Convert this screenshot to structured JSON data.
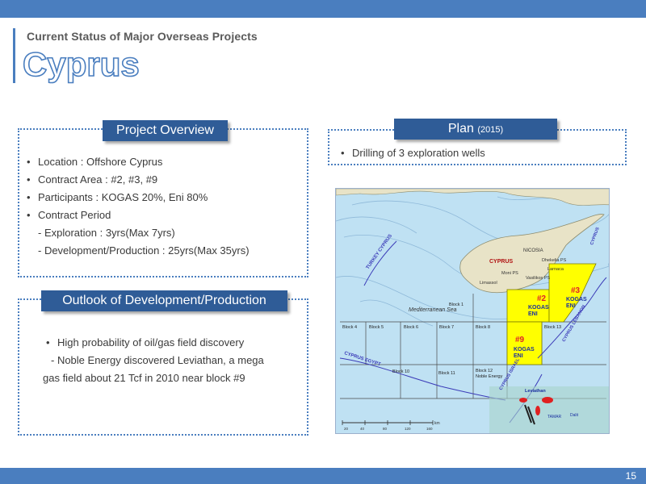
{
  "header": {
    "subtitle": "Current Status of Major Overseas Projects",
    "title": "Cyprus"
  },
  "overview": {
    "header": "Project Overview",
    "items": [
      "Location : Offshore Cyprus",
      "Contract Area : #2, #3, #9",
      "Participants : KOGAS 20%, Eni 80%",
      "Contract Period"
    ],
    "sub_items": [
      "- Exploration :  3yrs(Max 7yrs)",
      "- Development/Production : 25yrs(Max 35yrs)"
    ]
  },
  "plan": {
    "header": "Plan",
    "header_year": "(2015)",
    "items": [
      "Drilling of 3 exploration wells"
    ]
  },
  "outlook": {
    "header": "Outlook of Development/Production",
    "item": "High probability of oil/gas field discovery",
    "detail_line1": "- Noble Energy discovered Leviathan, a mega",
    "detail_line2": "gas field about 21 Tcf in 2010 near block #9"
  },
  "map": {
    "land_label": "CYPRUS",
    "city_nicosia": "NICOSIA",
    "city_dhekelia": "Dhekelia PS",
    "city_larnaca": "Larnaca",
    "city_moni": "Moni PS",
    "city_vasilikos": "Vasilikos PS",
    "city_limassol": "Limassol",
    "sea_label": "Mediterranean Sea",
    "border_turkey_cyprus": "TURKEY CYPRUS",
    "border_cyprus_egypt": "CYPRUS EGYPT",
    "border_cyprus_israel": "CYPRUS ISRAEL",
    "border_cyprus_lebanon": "CYPRUS LEBANON",
    "border_cyprus_syria": "CYPRUS",
    "block_labels": {
      "b1": "Block 1",
      "b4": "Block 4",
      "b5": "Block 5",
      "b6": "Block 6",
      "b7": "Block 7",
      "b8": "Block 8",
      "b10": "Block 10",
      "b11": "Block 11",
      "b12": "Block 12",
      "b13": "Block 13"
    },
    "noble_energy": "Noble Energy",
    "leviathan": "Leviathan",
    "tamar": "TAMAR",
    "dalit": "Dalit",
    "block2": {
      "number": "#2",
      "line1": "KOGAS",
      "line2": "ENI"
    },
    "block3": {
      "number": "#3",
      "line1": "KOGAS",
      "line2": "ENI"
    },
    "block9": {
      "number": "#9",
      "line1": "KOGAS",
      "line2": "ENI"
    },
    "scale": {
      "unit": "km",
      "ticks": [
        "20",
        "40",
        "80",
        "120",
        "160"
      ]
    }
  },
  "footer": {
    "page_number": "15"
  },
  "colors": {
    "bar": "#4a7ebf",
    "panel_header": "#2f5c97",
    "sea": "#bfe1f3",
    "land": "#e8e3c7",
    "block_highlight": "#ffff00",
    "block_number": "#e0202a",
    "block_company": "#1a2fa0",
    "border_label": "#3b3bb8"
  }
}
